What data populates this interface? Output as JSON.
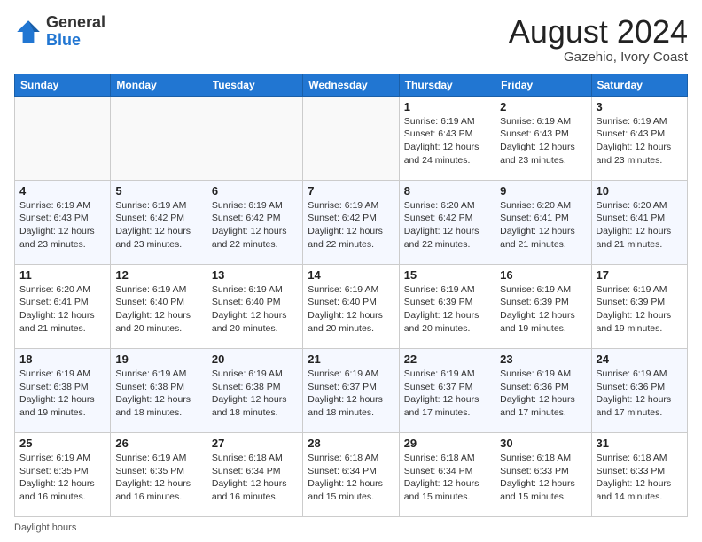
{
  "logo": {
    "general": "General",
    "blue": "Blue"
  },
  "title": "August 2024",
  "subtitle": "Gazehio, Ivory Coast",
  "days_of_week": [
    "Sunday",
    "Monday",
    "Tuesday",
    "Wednesday",
    "Thursday",
    "Friday",
    "Saturday"
  ],
  "footer_label": "Daylight hours",
  "weeks": [
    [
      {
        "day": "",
        "info": ""
      },
      {
        "day": "",
        "info": ""
      },
      {
        "day": "",
        "info": ""
      },
      {
        "day": "",
        "info": ""
      },
      {
        "day": "1",
        "info": "Sunrise: 6:19 AM\nSunset: 6:43 PM\nDaylight: 12 hours and 24 minutes."
      },
      {
        "day": "2",
        "info": "Sunrise: 6:19 AM\nSunset: 6:43 PM\nDaylight: 12 hours and 23 minutes."
      },
      {
        "day": "3",
        "info": "Sunrise: 6:19 AM\nSunset: 6:43 PM\nDaylight: 12 hours and 23 minutes."
      }
    ],
    [
      {
        "day": "4",
        "info": "Sunrise: 6:19 AM\nSunset: 6:43 PM\nDaylight: 12 hours and 23 minutes."
      },
      {
        "day": "5",
        "info": "Sunrise: 6:19 AM\nSunset: 6:42 PM\nDaylight: 12 hours and 23 minutes."
      },
      {
        "day": "6",
        "info": "Sunrise: 6:19 AM\nSunset: 6:42 PM\nDaylight: 12 hours and 22 minutes."
      },
      {
        "day": "7",
        "info": "Sunrise: 6:19 AM\nSunset: 6:42 PM\nDaylight: 12 hours and 22 minutes."
      },
      {
        "day": "8",
        "info": "Sunrise: 6:20 AM\nSunset: 6:42 PM\nDaylight: 12 hours and 22 minutes."
      },
      {
        "day": "9",
        "info": "Sunrise: 6:20 AM\nSunset: 6:41 PM\nDaylight: 12 hours and 21 minutes."
      },
      {
        "day": "10",
        "info": "Sunrise: 6:20 AM\nSunset: 6:41 PM\nDaylight: 12 hours and 21 minutes."
      }
    ],
    [
      {
        "day": "11",
        "info": "Sunrise: 6:20 AM\nSunset: 6:41 PM\nDaylight: 12 hours and 21 minutes."
      },
      {
        "day": "12",
        "info": "Sunrise: 6:19 AM\nSunset: 6:40 PM\nDaylight: 12 hours and 20 minutes."
      },
      {
        "day": "13",
        "info": "Sunrise: 6:19 AM\nSunset: 6:40 PM\nDaylight: 12 hours and 20 minutes."
      },
      {
        "day": "14",
        "info": "Sunrise: 6:19 AM\nSunset: 6:40 PM\nDaylight: 12 hours and 20 minutes."
      },
      {
        "day": "15",
        "info": "Sunrise: 6:19 AM\nSunset: 6:39 PM\nDaylight: 12 hours and 20 minutes."
      },
      {
        "day": "16",
        "info": "Sunrise: 6:19 AM\nSunset: 6:39 PM\nDaylight: 12 hours and 19 minutes."
      },
      {
        "day": "17",
        "info": "Sunrise: 6:19 AM\nSunset: 6:39 PM\nDaylight: 12 hours and 19 minutes."
      }
    ],
    [
      {
        "day": "18",
        "info": "Sunrise: 6:19 AM\nSunset: 6:38 PM\nDaylight: 12 hours and 19 minutes."
      },
      {
        "day": "19",
        "info": "Sunrise: 6:19 AM\nSunset: 6:38 PM\nDaylight: 12 hours and 18 minutes."
      },
      {
        "day": "20",
        "info": "Sunrise: 6:19 AM\nSunset: 6:38 PM\nDaylight: 12 hours and 18 minutes."
      },
      {
        "day": "21",
        "info": "Sunrise: 6:19 AM\nSunset: 6:37 PM\nDaylight: 12 hours and 18 minutes."
      },
      {
        "day": "22",
        "info": "Sunrise: 6:19 AM\nSunset: 6:37 PM\nDaylight: 12 hours and 17 minutes."
      },
      {
        "day": "23",
        "info": "Sunrise: 6:19 AM\nSunset: 6:36 PM\nDaylight: 12 hours and 17 minutes."
      },
      {
        "day": "24",
        "info": "Sunrise: 6:19 AM\nSunset: 6:36 PM\nDaylight: 12 hours and 17 minutes."
      }
    ],
    [
      {
        "day": "25",
        "info": "Sunrise: 6:19 AM\nSunset: 6:35 PM\nDaylight: 12 hours and 16 minutes."
      },
      {
        "day": "26",
        "info": "Sunrise: 6:19 AM\nSunset: 6:35 PM\nDaylight: 12 hours and 16 minutes."
      },
      {
        "day": "27",
        "info": "Sunrise: 6:18 AM\nSunset: 6:34 PM\nDaylight: 12 hours and 16 minutes."
      },
      {
        "day": "28",
        "info": "Sunrise: 6:18 AM\nSunset: 6:34 PM\nDaylight: 12 hours and 15 minutes."
      },
      {
        "day": "29",
        "info": "Sunrise: 6:18 AM\nSunset: 6:34 PM\nDaylight: 12 hours and 15 minutes."
      },
      {
        "day": "30",
        "info": "Sunrise: 6:18 AM\nSunset: 6:33 PM\nDaylight: 12 hours and 15 minutes."
      },
      {
        "day": "31",
        "info": "Sunrise: 6:18 AM\nSunset: 6:33 PM\nDaylight: 12 hours and 14 minutes."
      }
    ]
  ]
}
